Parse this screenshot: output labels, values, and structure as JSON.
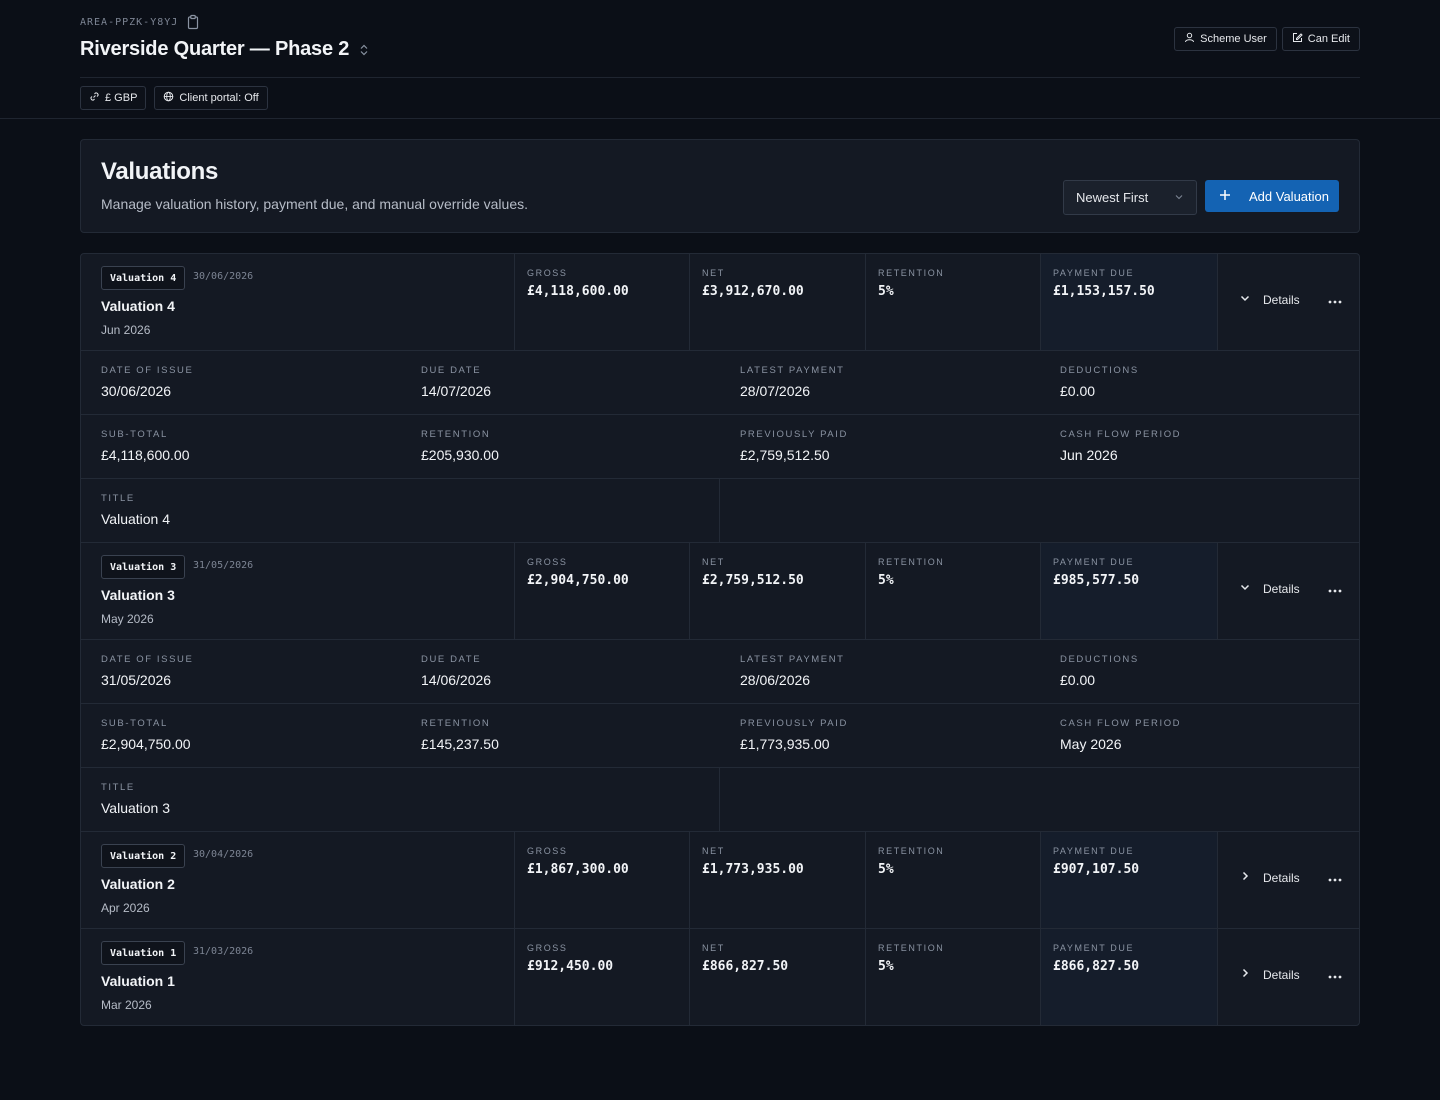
{
  "header": {
    "code": "AREA-PPZK-Y8YJ",
    "title": "Riverside Quarter — Phase 2",
    "role_button": "Scheme User",
    "permission_button": "Can Edit",
    "currency_pill": "£ GBP",
    "portal_pill": "Client portal: Off"
  },
  "valuations": {
    "title": "Valuations",
    "subtitle": "Manage valuation history, payment due, and manual override values.",
    "sort_value": "Newest First",
    "add_label": "Add Valuation"
  },
  "labels": {
    "gross": "GROSS",
    "net": "NET",
    "retention": "RETENTION",
    "payment_due": "PAYMENT DUE",
    "details": "Details",
    "date_of_issue": "DATE OF ISSUE",
    "due_date": "DUE DATE",
    "latest_payment": "LATEST PAYMENT",
    "deductions": "DEDUCTIONS",
    "sub_total": "SUB-TOTAL",
    "retention_detail": "RETENTION",
    "previously_paid": "PREVIOUSLY PAID",
    "cash_flow_period": "CASH FLOW PERIOD",
    "title": "TITLE"
  },
  "rows": [
    {
      "badge": "Valuation 4",
      "date": "30/06/2026",
      "name": "Valuation 4",
      "month": "Jun 2026",
      "gross": "£4,118,600.00",
      "net": "£3,912,670.00",
      "retention": "5%",
      "payment_due": "£1,153,157.50",
      "expanded": true,
      "detail": {
        "date_of_issue": "30/06/2026",
        "due_date": "14/07/2026",
        "latest_payment": "28/07/2026",
        "deductions": "£0.00",
        "sub_total": "£4,118,600.00",
        "retention": "£205,930.00",
        "previously_paid": "£2,759,512.50",
        "cash_flow_period": "Jun 2026",
        "title": "Valuation 4"
      }
    },
    {
      "badge": "Valuation 3",
      "date": "31/05/2026",
      "name": "Valuation 3",
      "month": "May 2026",
      "gross": "£2,904,750.00",
      "net": "£2,759,512.50",
      "retention": "5%",
      "payment_due": "£985,577.50",
      "expanded": true,
      "detail": {
        "date_of_issue": "31/05/2026",
        "due_date": "14/06/2026",
        "latest_payment": "28/06/2026",
        "deductions": "£0.00",
        "sub_total": "£2,904,750.00",
        "retention": "£145,237.50",
        "previously_paid": "£1,773,935.00",
        "cash_flow_period": "May 2026",
        "title": "Valuation 3"
      }
    },
    {
      "badge": "Valuation 2",
      "date": "30/04/2026",
      "name": "Valuation 2",
      "month": "Apr 2026",
      "gross": "£1,867,300.00",
      "net": "£1,773,935.00",
      "retention": "5%",
      "payment_due": "£907,107.50",
      "expanded": false
    },
    {
      "badge": "Valuation 1",
      "date": "31/03/2026",
      "name": "Valuation 1",
      "month": "Mar 2026",
      "gross": "£912,450.00",
      "net": "£866,827.50",
      "retention": "5%",
      "payment_due": "£866,827.50",
      "expanded": false
    }
  ],
  "icons": {
    "clipboard": "clipboard-icon",
    "sort_arrows": "sort-arrows-icon",
    "user": "user-icon",
    "edit": "edit-icon",
    "link": "link-icon",
    "globe": "globe-icon",
    "plus": "plus-icon",
    "chevron_down": "chevron-down-icon",
    "chevron_right": "chevron-right-icon",
    "more": "more-horizontal-icon"
  },
  "colors": {
    "background": "#0b0f17",
    "card": "#141923",
    "accent": "#1463b3",
    "border": "#232a36"
  }
}
